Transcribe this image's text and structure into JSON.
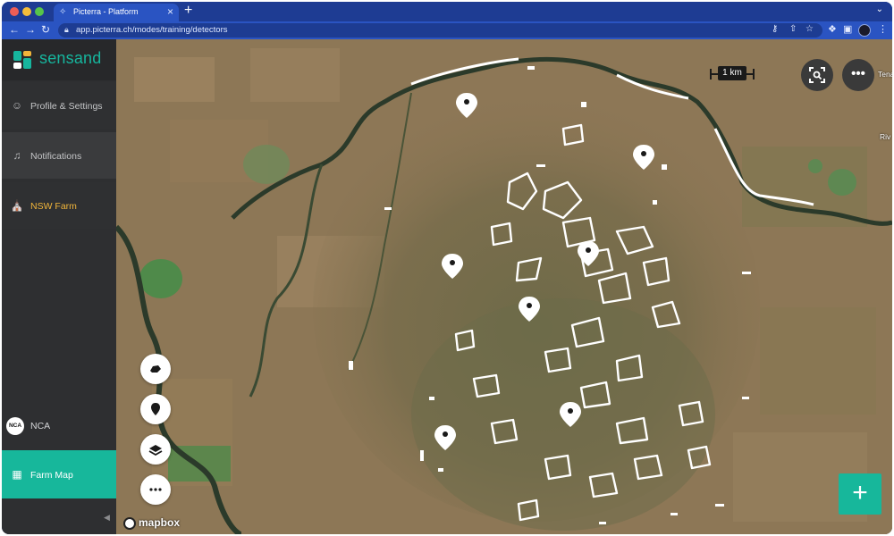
{
  "browser": {
    "tab_title": "Picterra - Platform",
    "url": "app.picterra.ch/modes/training/detectors",
    "icons": [
      "back-icon",
      "forward-icon",
      "reload-icon",
      "lock-icon",
      "key-icon",
      "share-icon",
      "star-icon",
      "extensions-icon",
      "sidebar-icon",
      "menu-icon"
    ]
  },
  "sidebar": {
    "brand": "sensand",
    "brand_color": "#16b59d",
    "items": [
      {
        "label": "Profile & Settings",
        "icon": "user-circle-icon"
      },
      {
        "label": "Notifications",
        "icon": "bell-icon"
      },
      {
        "label": "NSW Farm",
        "icon": "farm-icon"
      },
      {
        "label": "NCA",
        "icon": "nca-badge",
        "badge": "NCA"
      },
      {
        "label": "Farm Map",
        "icon": "map-icon",
        "active": true
      }
    ],
    "accent_color": "#17b79b",
    "highlight_color": "#f0b43a"
  },
  "map": {
    "scale_label": "1 km",
    "place_labels": [
      "Tena",
      "Riv"
    ],
    "attribution": "mapbox",
    "tools": [
      "draw-polygon-icon",
      "marker-icon",
      "layers-icon",
      "more-icon"
    ],
    "top_controls": [
      "screenshot-icon",
      "more-icon"
    ],
    "add_button_label": "+"
  }
}
